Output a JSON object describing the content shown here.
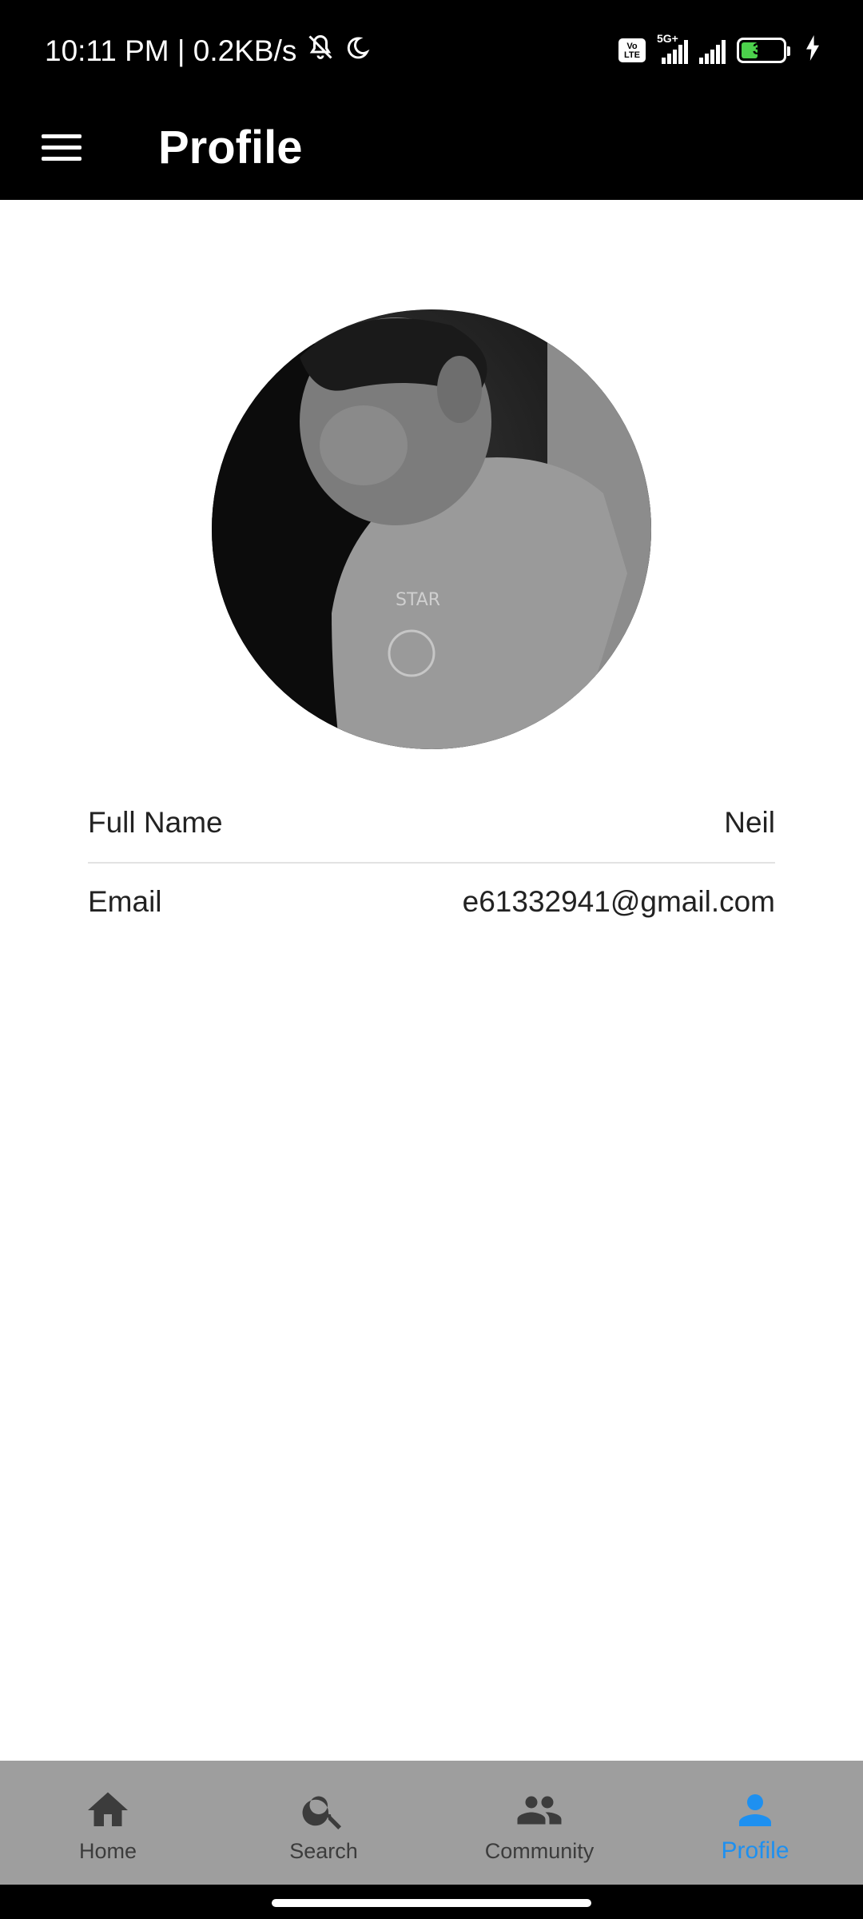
{
  "status_bar": {
    "time": "10:11 PM | 0.2KB/s",
    "volte": "Vo LTE",
    "network": "5G+",
    "battery_level": "38",
    "icons": [
      "mute-icon",
      "do-not-disturb-moon-icon",
      "volte-icon",
      "signal-icon",
      "signal-icon",
      "battery-icon",
      "charging-icon"
    ]
  },
  "app_bar": {
    "title": "Profile",
    "menu_icon": "hamburger-menu-icon"
  },
  "profile": {
    "avatar_description": "profile photo"
  },
  "fields": [
    {
      "label": "Full Name",
      "value": "Neil"
    },
    {
      "label": "Email",
      "value": "e61332941@gmail.com"
    }
  ],
  "bottom_nav": {
    "items": [
      {
        "label": "Home",
        "icon": "home-icon",
        "active": false
      },
      {
        "label": "Search",
        "icon": "search-icon",
        "active": false
      },
      {
        "label": "Community",
        "icon": "community-icon",
        "active": false
      },
      {
        "label": "Profile",
        "icon": "person-icon",
        "active": true
      }
    ],
    "active_color": "#1E90F0",
    "inactive_color": "#3C3C3C",
    "background": "#9E9E9E"
  }
}
